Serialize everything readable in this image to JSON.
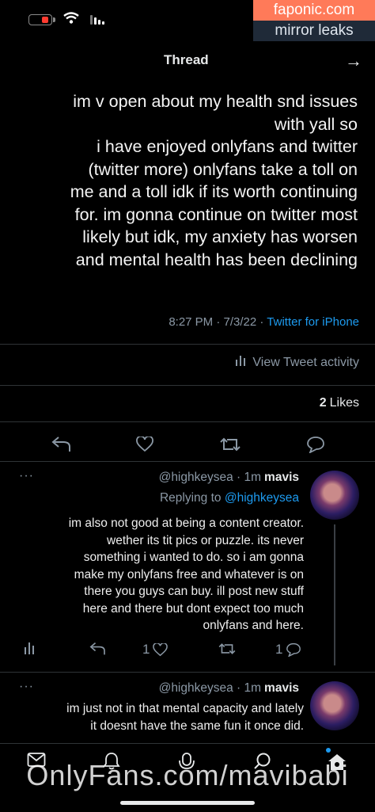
{
  "watermark": {
    "line1": "faponic.com",
    "line2": "mirror leaks"
  },
  "header": {
    "title": "Thread"
  },
  "tweet": {
    "lines": [
      "im v open about my health snd issues",
      "with yall so",
      "i have enjoyed onlyfans and twitter",
      "(twitter more) onlyfans take a toll on",
      "me and a toll idk if its worth continuing",
      "for. im gonna continue on twitter most",
      "likely but idk, my anxiety has worsen",
      "and mental health has been declining"
    ],
    "time": "8:27 PM · 7/3/22 · ",
    "source": "Twitter for iPhone",
    "activity": "View Tweet activity",
    "likes_count": "2",
    "likes_label": "Likes"
  },
  "replies": [
    {
      "name": "mavis",
      "handle": "@highkeysea · 1m",
      "replying_label": "Replying to ",
      "replying_handle": "@highkeysea",
      "more": "···",
      "lines": [
        "im also not good at being a content creator.",
        "wether its tit pics or puzzle. its never",
        "something i wanted to do. so i am gonna",
        "make my onlyfans free and whatever is on",
        "there you guys can buy. ill post new stuff",
        "here and there but dont expect too much",
        "onlyfans and here."
      ],
      "reply_count": "1",
      "like_count": "1"
    },
    {
      "name": "mavis",
      "handle": "@highkeysea · 1m",
      "more": "···",
      "lines": [
        "im just not in that mental capacity and lately",
        "it doesnt have the same fun it once did."
      ]
    }
  ],
  "overlay": {
    "onlyfans": "OnlyFans.com/mavibabi"
  },
  "icons": {
    "back": "arrow-icon",
    "activity": "bar-chart-icon",
    "reply": "comment-icon",
    "retweet": "retweet-icon",
    "like": "heart-icon",
    "share": "share-icon",
    "mail": "mail-icon",
    "bell": "bell-icon",
    "spaces": "spaces-icon",
    "search": "search-icon",
    "home": "home-icon"
  },
  "colors": {
    "accent": "#1d9bf0",
    "muted": "#8b98a5",
    "battery": "#ff3b30"
  }
}
